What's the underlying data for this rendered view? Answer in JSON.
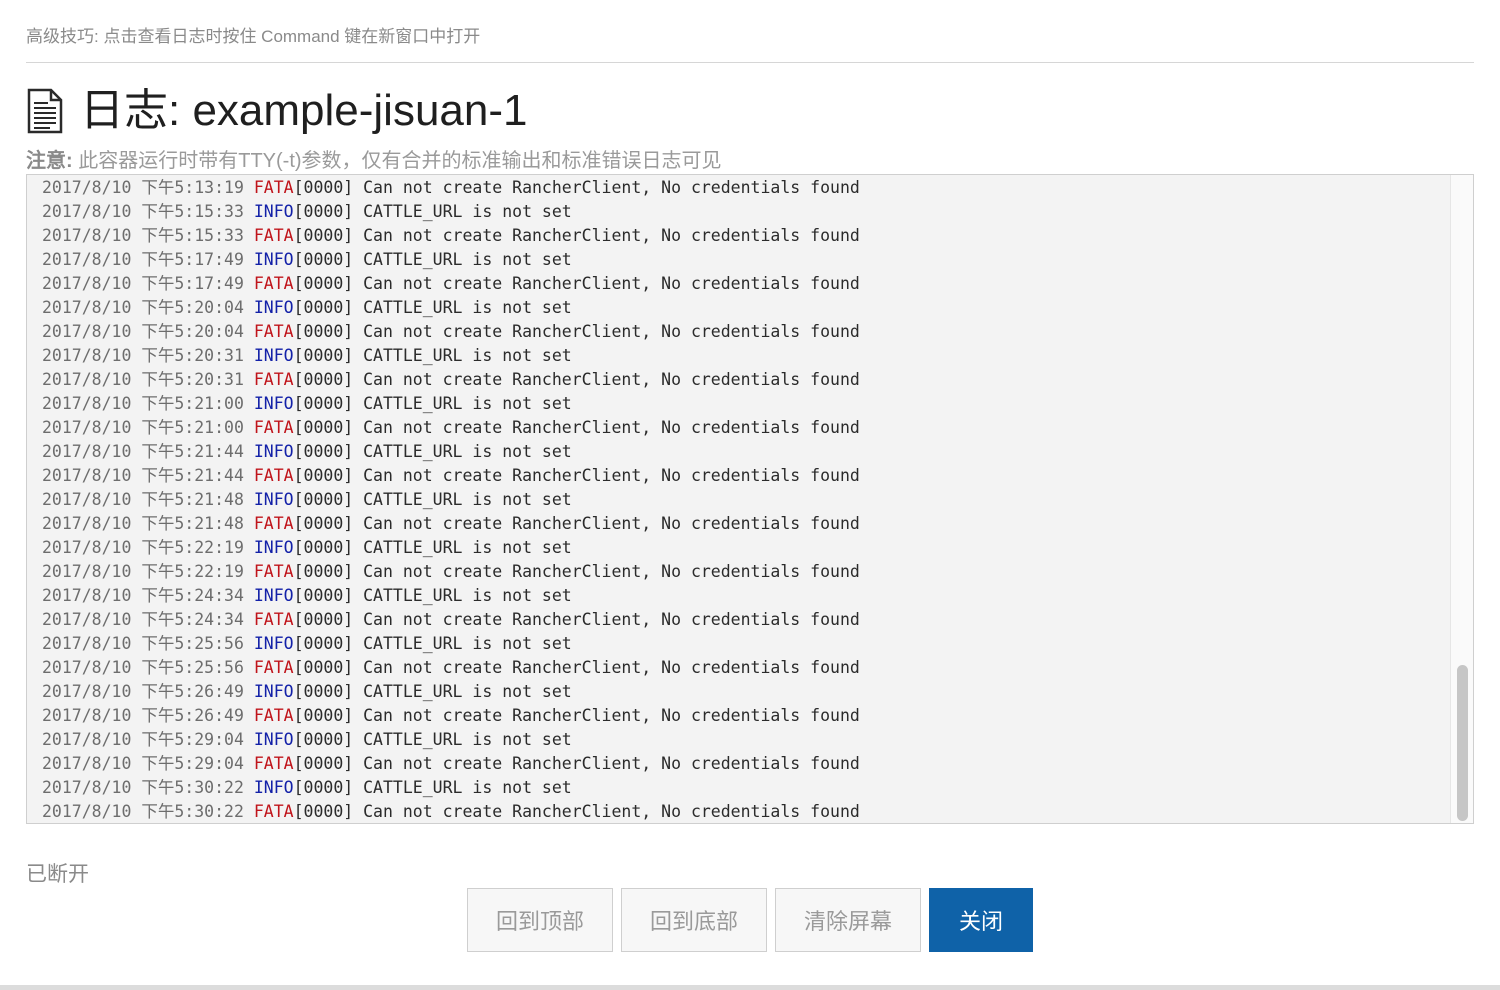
{
  "tip": "高级技巧: 点击查看日志时按住 Command 键在新窗口中打开",
  "header": {
    "icon": "document-icon",
    "title": "日志: example-jisuan-1"
  },
  "note": {
    "label": "注意:",
    "text": " 此容器运行时带有TTY(-t)参数，仅有合并的标准输出和标准错误日志可见"
  },
  "log": {
    "lines": [
      {
        "ts": "2017/8/10 下午5:13:19",
        "level": "FATA",
        "code": "[0000]",
        "msg": "Can not create RancherClient, No credentials found"
      },
      {
        "ts": "2017/8/10 下午5:15:33",
        "level": "INFO",
        "code": "[0000]",
        "msg": "CATTLE_URL is not set"
      },
      {
        "ts": "2017/8/10 下午5:15:33",
        "level": "FATA",
        "code": "[0000]",
        "msg": "Can not create RancherClient, No credentials found"
      },
      {
        "ts": "2017/8/10 下午5:17:49",
        "level": "INFO",
        "code": "[0000]",
        "msg": "CATTLE_URL is not set"
      },
      {
        "ts": "2017/8/10 下午5:17:49",
        "level": "FATA",
        "code": "[0000]",
        "msg": "Can not create RancherClient, No credentials found"
      },
      {
        "ts": "2017/8/10 下午5:20:04",
        "level": "INFO",
        "code": "[0000]",
        "msg": "CATTLE_URL is not set"
      },
      {
        "ts": "2017/8/10 下午5:20:04",
        "level": "FATA",
        "code": "[0000]",
        "msg": "Can not create RancherClient, No credentials found"
      },
      {
        "ts": "2017/8/10 下午5:20:31",
        "level": "INFO",
        "code": "[0000]",
        "msg": "CATTLE_URL is not set"
      },
      {
        "ts": "2017/8/10 下午5:20:31",
        "level": "FATA",
        "code": "[0000]",
        "msg": "Can not create RancherClient, No credentials found"
      },
      {
        "ts": "2017/8/10 下午5:21:00",
        "level": "INFO",
        "code": "[0000]",
        "msg": "CATTLE_URL is not set"
      },
      {
        "ts": "2017/8/10 下午5:21:00",
        "level": "FATA",
        "code": "[0000]",
        "msg": "Can not create RancherClient, No credentials found"
      },
      {
        "ts": "2017/8/10 下午5:21:44",
        "level": "INFO",
        "code": "[0000]",
        "msg": "CATTLE_URL is not set"
      },
      {
        "ts": "2017/8/10 下午5:21:44",
        "level": "FATA",
        "code": "[0000]",
        "msg": "Can not create RancherClient, No credentials found"
      },
      {
        "ts": "2017/8/10 下午5:21:48",
        "level": "INFO",
        "code": "[0000]",
        "msg": "CATTLE_URL is not set"
      },
      {
        "ts": "2017/8/10 下午5:21:48",
        "level": "FATA",
        "code": "[0000]",
        "msg": "Can not create RancherClient, No credentials found"
      },
      {
        "ts": "2017/8/10 下午5:22:19",
        "level": "INFO",
        "code": "[0000]",
        "msg": "CATTLE_URL is not set"
      },
      {
        "ts": "2017/8/10 下午5:22:19",
        "level": "FATA",
        "code": "[0000]",
        "msg": "Can not create RancherClient, No credentials found"
      },
      {
        "ts": "2017/8/10 下午5:24:34",
        "level": "INFO",
        "code": "[0000]",
        "msg": "CATTLE_URL is not set"
      },
      {
        "ts": "2017/8/10 下午5:24:34",
        "level": "FATA",
        "code": "[0000]",
        "msg": "Can not create RancherClient, No credentials found"
      },
      {
        "ts": "2017/8/10 下午5:25:56",
        "level": "INFO",
        "code": "[0000]",
        "msg": "CATTLE_URL is not set"
      },
      {
        "ts": "2017/8/10 下午5:25:56",
        "level": "FATA",
        "code": "[0000]",
        "msg": "Can not create RancherClient, No credentials found"
      },
      {
        "ts": "2017/8/10 下午5:26:49",
        "level": "INFO",
        "code": "[0000]",
        "msg": "CATTLE_URL is not set"
      },
      {
        "ts": "2017/8/10 下午5:26:49",
        "level": "FATA",
        "code": "[0000]",
        "msg": "Can not create RancherClient, No credentials found"
      },
      {
        "ts": "2017/8/10 下午5:29:04",
        "level": "INFO",
        "code": "[0000]",
        "msg": "CATTLE_URL is not set"
      },
      {
        "ts": "2017/8/10 下午5:29:04",
        "level": "FATA",
        "code": "[0000]",
        "msg": "Can not create RancherClient, No credentials found"
      },
      {
        "ts": "2017/8/10 下午5:30:22",
        "level": "INFO",
        "code": "[0000]",
        "msg": "CATTLE_URL is not set"
      },
      {
        "ts": "2017/8/10 下午5:30:22",
        "level": "FATA",
        "code": "[0000]",
        "msg": "Can not create RancherClient, No credentials found"
      }
    ],
    "level_colors": {
      "FATA": "#c0141b",
      "INFO": "#1321a8"
    }
  },
  "status": "已断开",
  "buttons": {
    "scroll_top": "回到顶部",
    "scroll_bottom": "回到底部",
    "clear": "清除屏幕",
    "close": "关闭"
  },
  "colors": {
    "primary": "#0f62a8"
  }
}
